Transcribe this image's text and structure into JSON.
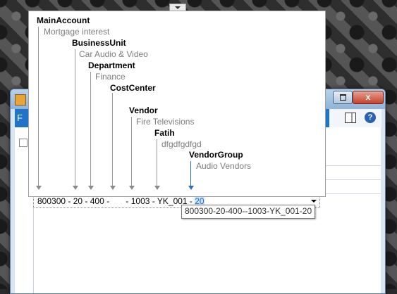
{
  "window": {
    "ribbon_tab": "F",
    "close_label": "x",
    "help_label": "?"
  },
  "segments": [
    {
      "name": "MainAccount",
      "description": "Mortgage interest",
      "value": "800300"
    },
    {
      "name": "BusinessUnit",
      "description": "Car Audio & Video",
      "value": "20"
    },
    {
      "name": "Department",
      "description": "Finance",
      "value": "400"
    },
    {
      "name": "CostCenter",
      "description": "",
      "value": ""
    },
    {
      "name": "Vendor",
      "description": "Fire Televisions",
      "value": "1003"
    },
    {
      "name": "Fatih",
      "description": "dfgdfgdfgd",
      "value": "YK_001"
    },
    {
      "name": "VendorGroup",
      "description": "Audio Vendors",
      "value": "20"
    }
  ],
  "field": {
    "text_before_selection": "800300 - 20 - 400 -       - 1003 - YK_001 - ",
    "selected_text": "20",
    "tooltip": "800300-20-400--1003-YK_001-20"
  },
  "colors": {
    "active_segment": "#2c6fc0",
    "ribbon": "#1e74c8"
  }
}
